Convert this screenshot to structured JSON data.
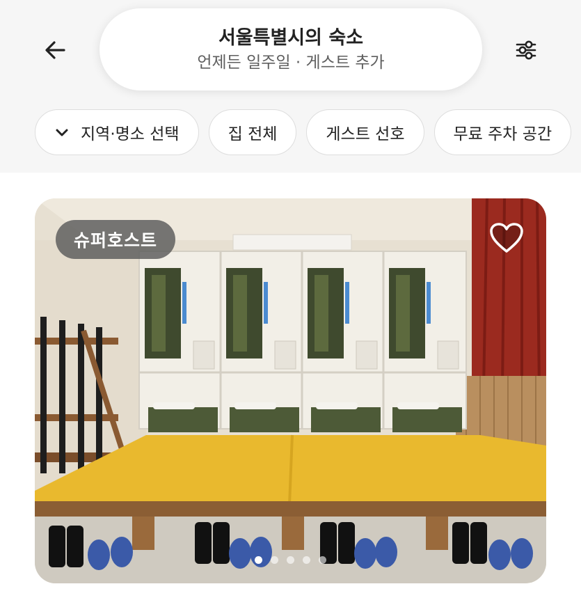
{
  "header": {
    "back_icon": "arrow-left-icon",
    "search": {
      "title": "서울특별시의 숙소",
      "subtitle": "언제든 일주일 · 게스트 추가"
    },
    "filter_icon": "sliders-icon"
  },
  "filters": [
    {
      "label": "지역·명소 선택",
      "icon": "chevron-down-icon"
    },
    {
      "label": "집 전체"
    },
    {
      "label": "게스트 선호"
    },
    {
      "label": "무료 주차 공간"
    }
  ],
  "listing": {
    "badge": "슈퍼호스트",
    "wishlist_icon": "heart-outline-icon",
    "photo_description_icon": "photo",
    "carousel": {
      "total_dots": 5,
      "active_index": 0
    }
  },
  "colors": {
    "badge_bg": "#5a5a5a",
    "header_bg": "#f6f6f6",
    "text": "#222222",
    "subtext": "#5e5e5e"
  }
}
